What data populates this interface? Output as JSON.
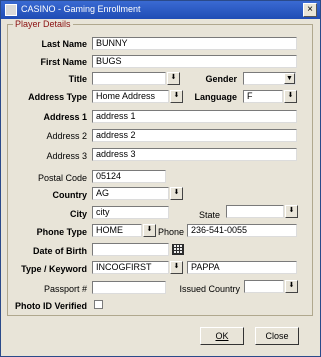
{
  "window": {
    "title": "CASINO - Gaming Enrollment",
    "close_glyph": "×"
  },
  "group": {
    "legend": "Player Details"
  },
  "labels": {
    "last_name": "Last Name",
    "first_name": "First Name",
    "title": "Title",
    "gender": "Gender",
    "address_type": "Address Type",
    "language": "Language",
    "address1": "Address 1",
    "address2": "Address 2",
    "address3": "Address 3",
    "postal_code": "Postal Code",
    "country": "Country",
    "city": "City",
    "state": "State",
    "phone_type": "Phone Type",
    "phone": "Phone",
    "dob": "Date of Birth",
    "type_keyword": "Type / Keyword",
    "passport": "Passport #",
    "issued_country": "Issued Country",
    "photo_id": "Photo ID Verified"
  },
  "values": {
    "last_name": "BUNNY",
    "first_name": "BUGS",
    "title": "",
    "gender": "",
    "address_type": "Home Address",
    "language": "F",
    "address1": "address 1",
    "address2": "address 2",
    "address3": "address 3",
    "postal_code": "05124",
    "country": "AG",
    "city": "city",
    "state": "",
    "phone_type": "HOME",
    "phone": "236-541-0055",
    "dob": "",
    "type": "INCOGFIRST",
    "keyword": "PAPPA",
    "passport": "",
    "issued_country": "",
    "photo_id_verified": false
  },
  "buttons": {
    "ok": "OK",
    "close": "Close"
  },
  "glyphs": {
    "lov": "⬇",
    "combo": "▼"
  }
}
